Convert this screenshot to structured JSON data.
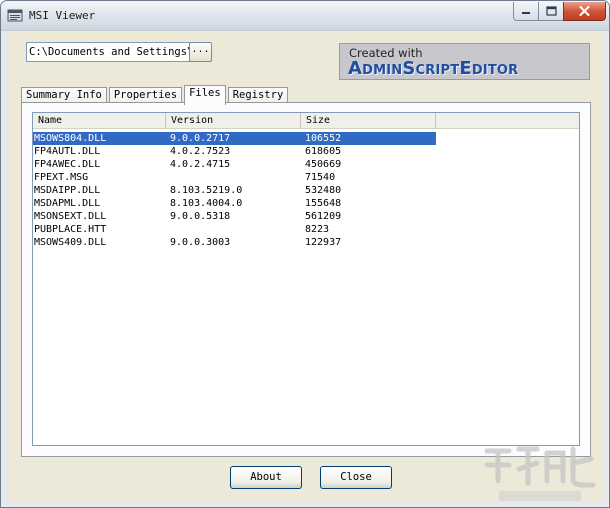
{
  "window": {
    "title": "MSI Viewer",
    "icon": "msi-app-icon",
    "controls": [
      "minimize-icon",
      "maximize-icon",
      "close-icon"
    ]
  },
  "path": {
    "value": "C:\\Documents and Settings\\.",
    "browse_label": "..."
  },
  "banner": {
    "small_text": "Created with",
    "big_text": "AdminScriptEditor"
  },
  "tabs": [
    {
      "label": "Summary Info",
      "active": false
    },
    {
      "label": "Properties",
      "active": false
    },
    {
      "label": "Files",
      "active": true
    },
    {
      "label": "Registry",
      "active": false
    }
  ],
  "files": {
    "columns": [
      "Name",
      "Version",
      "Size"
    ],
    "rows": [
      {
        "name": "MSOWS804.DLL",
        "version": "9.0.0.2717",
        "size": "106552",
        "selected": true
      },
      {
        "name": "FP4AUTL.DLL",
        "version": "4.0.2.7523",
        "size": "618605",
        "selected": false
      },
      {
        "name": "FP4AWEC.DLL",
        "version": "4.0.2.4715",
        "size": "450669",
        "selected": false
      },
      {
        "name": "FPEXT.MSG",
        "version": "",
        "size": "71540",
        "selected": false
      },
      {
        "name": "MSDAIPP.DLL",
        "version": "8.103.5219.0",
        "size": "532480",
        "selected": false
      },
      {
        "name": "MSDAPML.DLL",
        "version": "8.103.4004.0",
        "size": "155648",
        "selected": false
      },
      {
        "name": "MSONSEXT.DLL",
        "version": "9.0.0.5318",
        "size": "561209",
        "selected": false
      },
      {
        "name": "PUBPLACE.HTT",
        "version": "",
        "size": "8223",
        "selected": false
      },
      {
        "name": "MSOWS409.DLL",
        "version": "9.0.0.3003",
        "size": "122937",
        "selected": false
      }
    ]
  },
  "buttons": {
    "about": "About",
    "close": "Close"
  },
  "colors": {
    "selection": "#316ac5",
    "banner_text": "#1f4f9e",
    "close_button": "#c13b1d"
  }
}
